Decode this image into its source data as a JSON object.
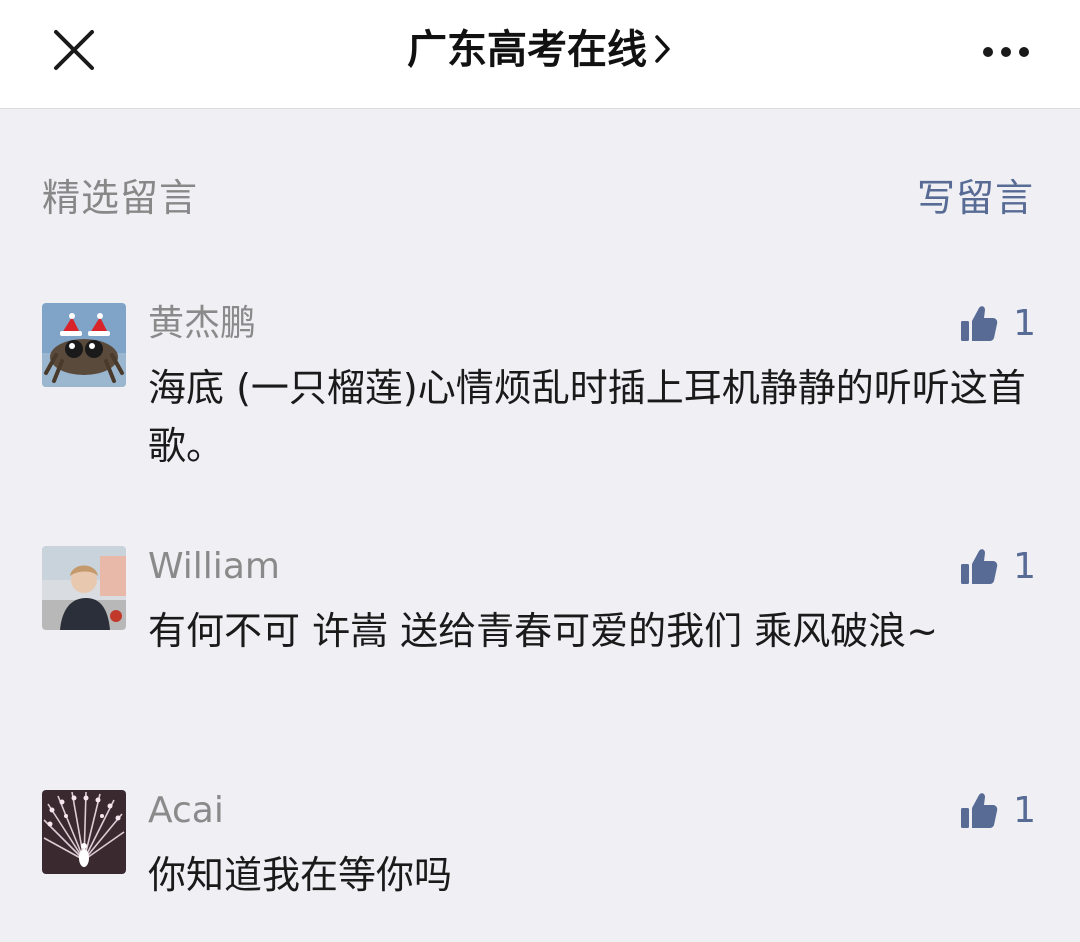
{
  "header": {
    "title": "广东高考在线",
    "close_icon": "close-icon",
    "chevron_icon": "chevron-right-icon",
    "more_icon": "more-dots-icon"
  },
  "section": {
    "title": "精选留言",
    "write_label": "写留言"
  },
  "colors": {
    "link_blue": "#576b95",
    "background": "#efeff4",
    "nick_gray": "#8a8a8a"
  },
  "comments": [
    {
      "nickname": "黄杰鹏",
      "content": "海底 (一只榴莲)心情烦乱时插上耳机静静的听听这首歌。",
      "likes": "1",
      "avatar": "spider-with-santa-hats-avatar"
    },
    {
      "nickname": "William",
      "content": "有何不可 许嵩 送给青春可爱的我们 乘风破浪~",
      "likes": "1",
      "avatar": "person-photo-avatar"
    },
    {
      "nickname": "Acai",
      "content": "你知道我在等你吗",
      "likes": "1",
      "avatar": "white-peacock-avatar"
    }
  ]
}
